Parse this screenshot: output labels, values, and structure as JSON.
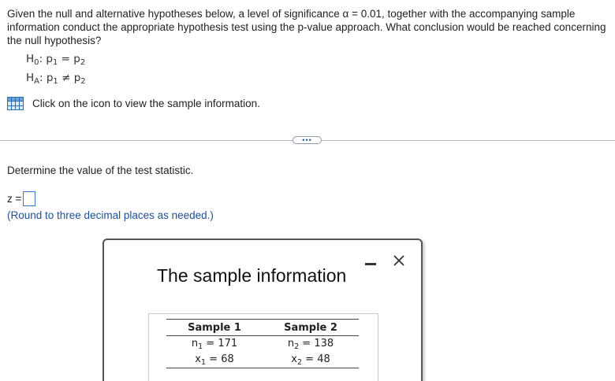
{
  "question": {
    "text": "Given the null and alternative hypotheses below, a level of significance α = 0.01, together with the accompanying sample information conduct the appropriate hypothesis test using the p-value approach. What conclusion would be reached concerning the null hypothesis?"
  },
  "hypotheses": {
    "h0": {
      "lhs": "H",
      "lhs_sub": "0",
      "sep": ": ",
      "p1": "p",
      "p1_sub": "1",
      "op": " = ",
      "p2": "p",
      "p2_sub": "2"
    },
    "ha": {
      "lhs": "H",
      "lhs_sub": "A",
      "sep": ": ",
      "p1": "p",
      "p1_sub": "1",
      "op": " ≠ ",
      "p2": "p",
      "p2_sub": "2"
    }
  },
  "sample_link": {
    "icon": "table-grid-icon",
    "label": "Click on the icon to view the sample information."
  },
  "more_button": {
    "label": "•••"
  },
  "part": {
    "prompt": "Determine the value of the test statistic.",
    "answer_label": "z =",
    "answer_value": "",
    "hint": "(Round to three decimal places as needed.)"
  },
  "dialog": {
    "title": "The sample information",
    "minimize_icon": "minimize-icon",
    "close_icon": "close-icon",
    "table": {
      "headers": [
        "Sample 1",
        "Sample 2"
      ],
      "rows": [
        [
          {
            "var": "n",
            "sub": "1",
            "eq": " = ",
            "val": "171"
          },
          {
            "var": "n",
            "sub": "2",
            "eq": " = ",
            "val": "138"
          }
        ],
        [
          {
            "var": "x",
            "sub": "1",
            "eq": " = ",
            "val": "68"
          },
          {
            "var": "x",
            "sub": "2",
            "eq": " = ",
            "val": "48"
          }
        ]
      ]
    }
  },
  "colors": {
    "accent": "#1f4f96",
    "icon_blue": "#2a6fb0",
    "input_border": "#3b78c8"
  }
}
